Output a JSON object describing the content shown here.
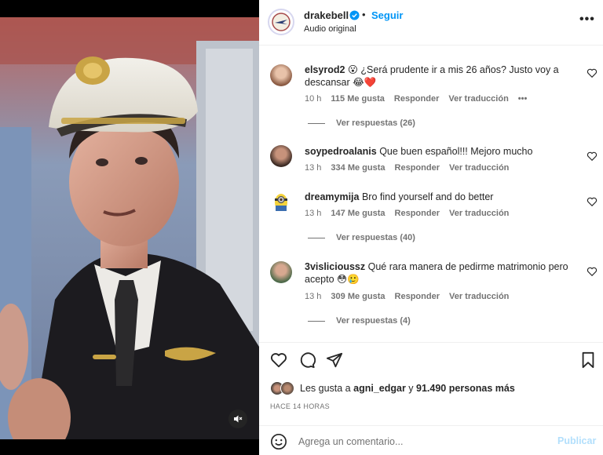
{
  "colors": {
    "accent": "#0095f6",
    "muted": "#737373",
    "text": "#262626",
    "publish_disabled": "#b2dffc"
  },
  "post": {
    "username": "drakebell",
    "follow_label": "Seguir",
    "separator": "•",
    "audio": "Audio original",
    "more_icon": "more-horizontal-icon"
  },
  "comments": [
    {
      "username": "elsyrod2",
      "text": "😮 ¿Será prudente ir a mis 26 años? Justo voy a descansar 😂❤️",
      "time": "10 h",
      "likes": "115 Me gusta",
      "reply_label": "Responder",
      "translate_label": "Ver traducción",
      "options": "•••",
      "replies": "Ver respuestas (26)"
    },
    {
      "username": "soypedroalanis",
      "text": "Que buen español!!! Mejoro mucho",
      "time": "13 h",
      "likes": "334 Me gusta",
      "reply_label": "Responder",
      "translate_label": "Ver traducción"
    },
    {
      "username": "dreamymija",
      "text": "Bro find yourself and do better",
      "time": "13 h",
      "likes": "147 Me gusta",
      "reply_label": "Responder",
      "translate_label": "Ver traducción",
      "replies": "Ver respuestas (40)"
    },
    {
      "username": "3vislicioussz",
      "text": "Qué rara manera de pedirme matrimonio pero acepto 😳🥲",
      "time": "13 h",
      "likes": "309 Me gusta",
      "reply_label": "Responder",
      "translate_label": "Ver traducción",
      "replies": "Ver respuestas (4)"
    }
  ],
  "likes": {
    "prefix": "Les gusta a",
    "user": "agni_edgar",
    "joiner": "y",
    "count": "91.490 personas más"
  },
  "timestamp": "HACE 14 HORAS",
  "comment_box": {
    "placeholder": "Agrega un comentario...",
    "publish_label": "Publicar"
  }
}
